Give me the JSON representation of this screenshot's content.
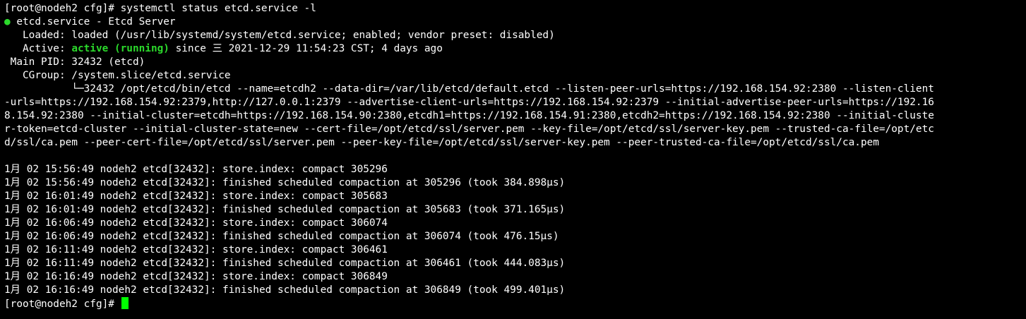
{
  "terminal": {
    "prompt": "[root@nodeh2 cfg]#",
    "command": " systemctl status etcd.service -l",
    "status": {
      "dot": "●",
      "title": " etcd.service - Etcd Server",
      "loaded": "   Loaded: loaded (/usr/lib/systemd/system/etcd.service; enabled; vendor preset: disabled)",
      "active_label": "   Active: ",
      "active_state": "active (running)",
      "active_since": " since 三 2021-12-29 11:54:23 CST; 4 days ago",
      "main_pid": " Main PID: 32432 (etcd)",
      "cgroup": "   CGroup: /system.slice/etcd.service",
      "process_lines": [
        "           └─32432 /opt/etcd/bin/etcd --name=etcdh2 --data-dir=/var/lib/etcd/default.etcd --listen-peer-urls=https://192.168.154.92:2380 --listen-client",
        "-urls=https://192.168.154.92:2379,http://127.0.0.1:2379 --advertise-client-urls=https://192.168.154.92:2379 --initial-advertise-peer-urls=https://192.16",
        "8.154.92:2380 --initial-cluster=etcdh=https://192.168.154.90:2380,etcdh1=https://192.168.154.91:2380,etcdh2=https://192.168.154.92:2380 --initial-cluste",
        "r-token=etcd-cluster --initial-cluster-state=new --cert-file=/opt/etcd/ssl/server.pem --key-file=/opt/etcd/ssl/server-key.pem --trusted-ca-file=/opt/etc",
        "d/ssl/ca.pem --peer-cert-file=/opt/etcd/ssl/server.pem --peer-key-file=/opt/etcd/ssl/server-key.pem --peer-trusted-ca-file=/opt/etcd/ssl/ca.pem"
      ]
    },
    "logs": [
      "1月 02 15:56:49 nodeh2 etcd[32432]: store.index: compact 305296",
      "1月 02 15:56:49 nodeh2 etcd[32432]: finished scheduled compaction at 305296 (took 384.898µs)",
      "1月 02 16:01:49 nodeh2 etcd[32432]: store.index: compact 305683",
      "1月 02 16:01:49 nodeh2 etcd[32432]: finished scheduled compaction at 305683 (took 371.165µs)",
      "1月 02 16:06:49 nodeh2 etcd[32432]: store.index: compact 306074",
      "1月 02 16:06:49 nodeh2 etcd[32432]: finished scheduled compaction at 306074 (took 476.15µs)",
      "1月 02 16:11:49 nodeh2 etcd[32432]: store.index: compact 306461",
      "1月 02 16:11:49 nodeh2 etcd[32432]: finished scheduled compaction at 306461 (took 444.083µs)",
      "1月 02 16:16:49 nodeh2 etcd[32432]: store.index: compact 306849",
      "1月 02 16:16:49 nodeh2 etcd[32432]: finished scheduled compaction at 306849 (took 499.401µs)"
    ],
    "final_prompt": "[root@nodeh2 cfg]# ",
    "colors": {
      "background": "#000000",
      "text": "#ffffff",
      "status_green": "#2bd92b",
      "cursor": "#00ff00"
    }
  }
}
